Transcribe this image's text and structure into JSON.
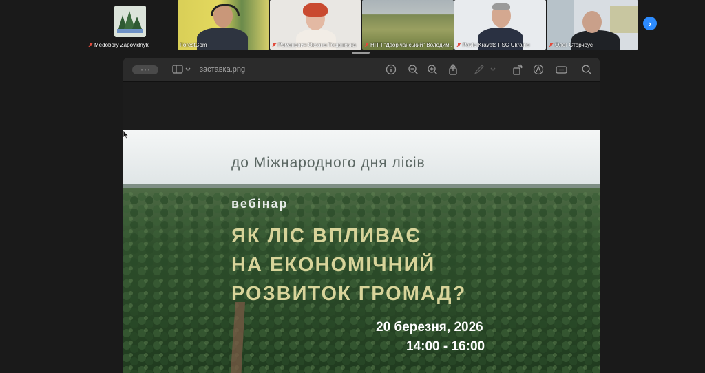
{
  "participants": [
    {
      "name": "Medobory Zapovidnyk",
      "muted": true,
      "has_video": false
    },
    {
      "name": "ForestCom",
      "muted": false,
      "has_video": true,
      "active": true
    },
    {
      "name": "Романович Оксана Гощанська",
      "muted": true,
      "has_video": true
    },
    {
      "name": "НПП \"Дворічанський\" Володим...",
      "muted": true,
      "has_video": true
    },
    {
      "name": "Pavlo Kravets FSC Ukraine",
      "muted": true,
      "has_video": true
    },
    {
      "name": "Олег Сторчоус",
      "muted": true,
      "has_video": true
    }
  ],
  "next_page_icon": "chevron-right-icon",
  "viewer": {
    "filename": "заставка.png",
    "toolbar_icons": [
      "sidebar-icon",
      "info-icon",
      "zoom-out-icon",
      "zoom-in-icon",
      "share-icon",
      "markup-pen-icon",
      "rotate-icon",
      "annotate-icon",
      "redact-icon",
      "search-icon"
    ]
  },
  "slide": {
    "caption": "до Міжнародного дня лісів",
    "kicker": "вебінар",
    "headline": [
      "ЯК ЛІС ВПЛИВАЄ",
      "НА ЕКОНОМІЧНИЙ",
      "РОЗВИТОК ГРОМАД?"
    ],
    "date": "20 березня, 2026",
    "time": "14:00 - 16:00"
  },
  "colors": {
    "active_speaker": "#6cc04a",
    "next_button": "#2d8cff",
    "headline": "#d8d49a",
    "mic_muted": "#e24a3b"
  }
}
